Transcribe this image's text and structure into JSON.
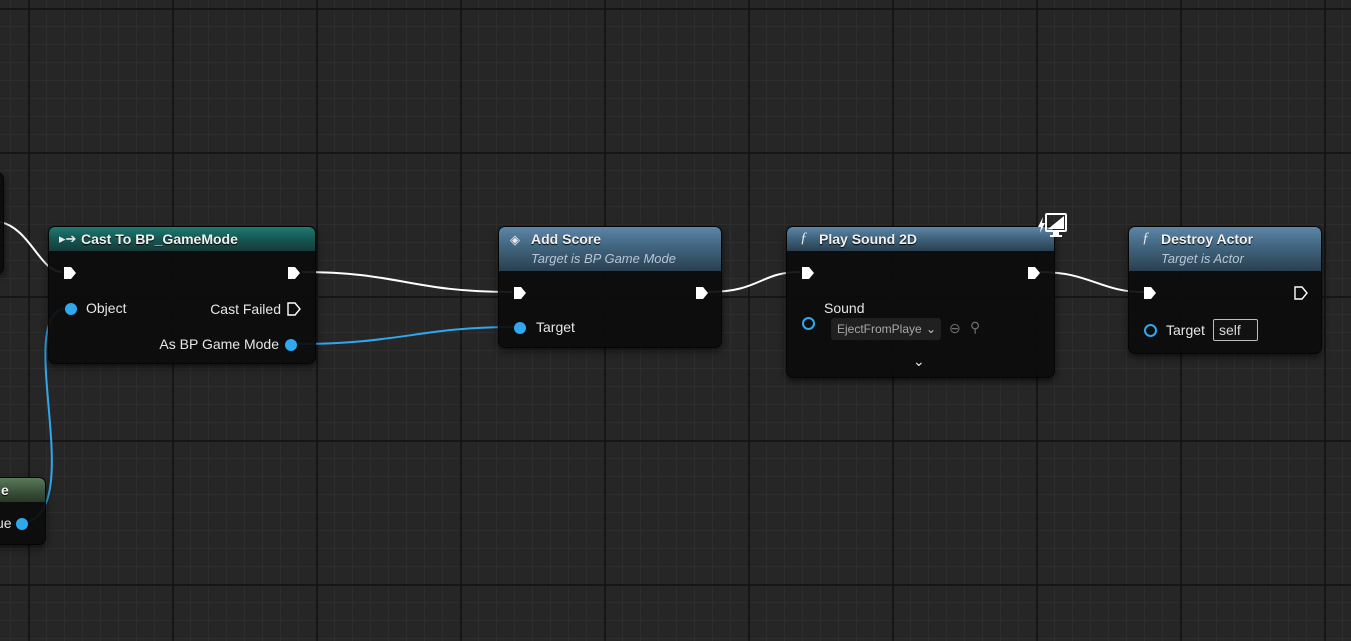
{
  "nodes": {
    "cast": {
      "title": "Cast To BP_GameMode",
      "pins": {
        "object": "Object",
        "cast_failed": "Cast Failed",
        "as_game_mode": "As BP Game Mode"
      }
    },
    "add_score": {
      "title": "Add Score",
      "subtitle": "Target is BP Game Mode",
      "pins": {
        "target": "Target"
      }
    },
    "play_sound": {
      "title": "Play Sound 2D",
      "pins": {
        "sound": "Sound"
      },
      "sound_value": "EjectFromPlaye"
    },
    "destroy": {
      "title": "Destroy Actor",
      "subtitle": "Target is Actor",
      "pins": {
        "target": "Target"
      },
      "target_value": "self"
    },
    "partial": {
      "title_fragment": "e",
      "pin_fragment": "ue"
    }
  },
  "icons": {
    "cast": "cast-arrow-icon",
    "event": "event-diamond-icon",
    "function": "function-f-icon",
    "client_only": "monitor-lightning-icon"
  },
  "colors": {
    "exec_wire": "#ffffff",
    "object_wire": "#2fa8ee",
    "teal_header": "#1f7a72",
    "function_header": "#5d85a8",
    "grid_bg": "#262626"
  }
}
